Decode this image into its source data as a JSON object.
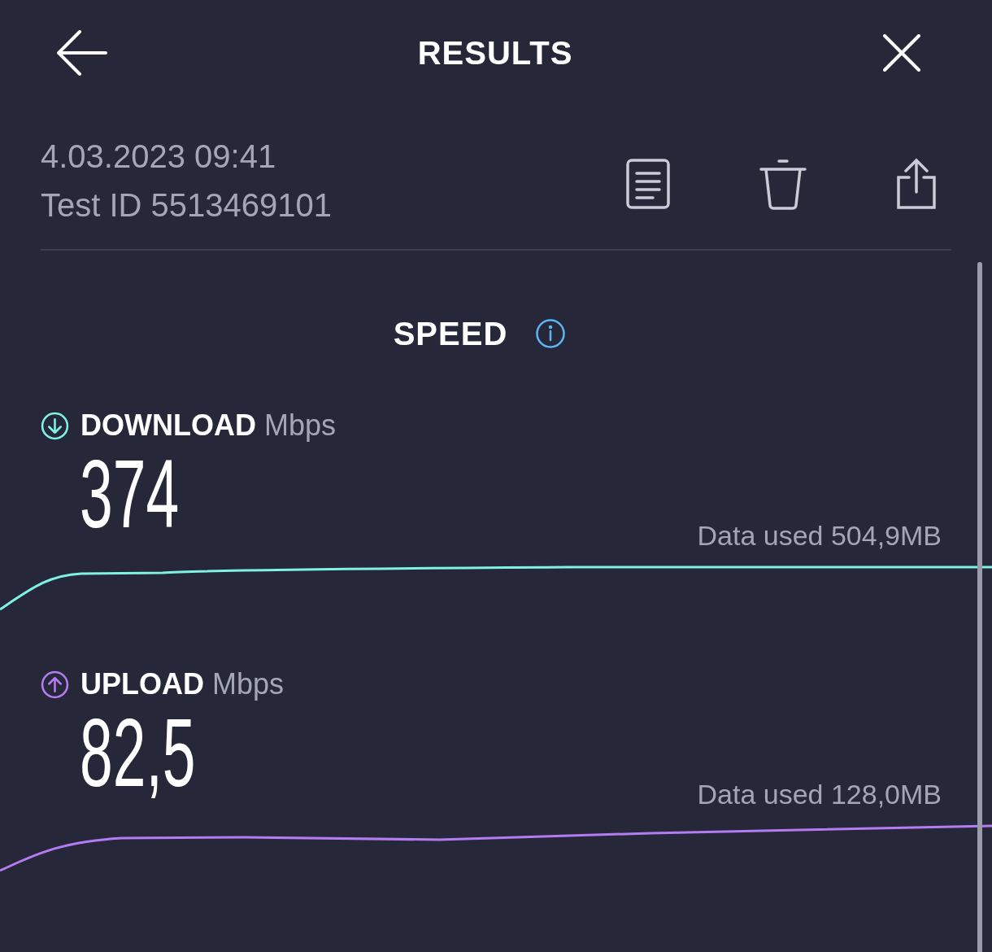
{
  "header": {
    "title": "RESULTS"
  },
  "test": {
    "date": "4.03.2023 09:41",
    "test_id": "Test ID 5513469101"
  },
  "section": {
    "title": "SPEED"
  },
  "metrics": [
    {
      "kind": "download",
      "label": "DOWNLOAD",
      "unit": "Mbps",
      "value": "374",
      "data_used": "Data used 504,9MB",
      "color": "#7ff3e3"
    },
    {
      "kind": "upload",
      "label": "UPLOAD",
      "unit": "Mbps",
      "value": "82,5",
      "data_used": "Data used 128,0MB",
      "color": "#b47cf3"
    }
  ]
}
